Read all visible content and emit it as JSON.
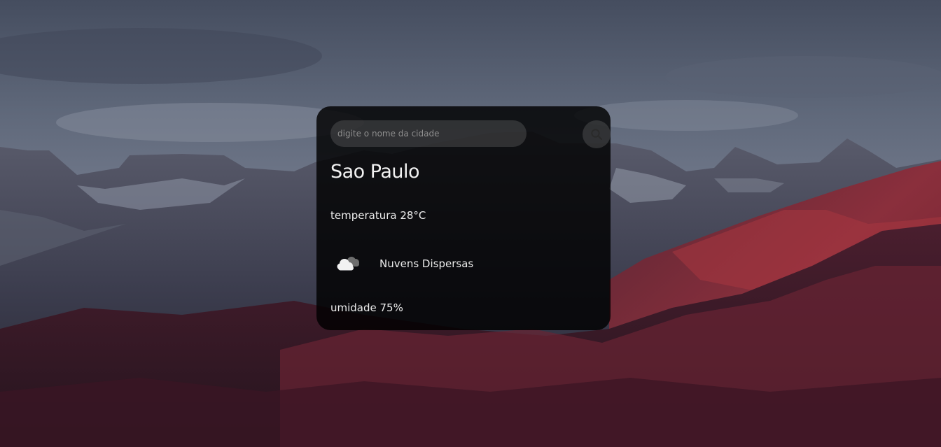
{
  "search": {
    "placeholder": "digite o nome da cidade",
    "value": ""
  },
  "weather": {
    "city": "Sao Paulo",
    "temperature": "temperatura 28°C",
    "description": "Nuvens Dispersas",
    "humidity": "umidade 75%",
    "icon": "scattered-clouds-icon"
  },
  "icons": {
    "search_button": "search-icon"
  },
  "colors": {
    "card_background": "#000000",
    "text": "#ececec",
    "input_background": "#4f4f4f"
  }
}
